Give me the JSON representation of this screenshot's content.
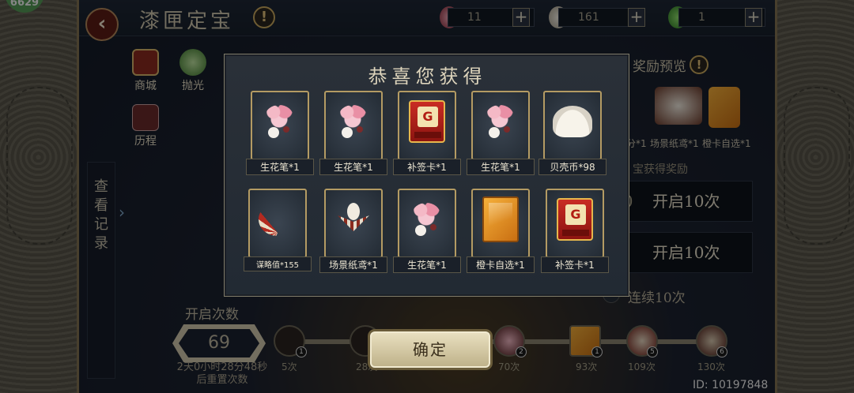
{
  "header": {
    "title": "漆匣定宝",
    "resources": [
      {
        "name": "生花笔",
        "value": "11",
        "icon": "flower-brush-icon"
      },
      {
        "name": "贝壳币",
        "value": "161",
        "icon": "shell-icon"
      },
      {
        "name": "gem",
        "value": "1",
        "icon": "green-gem-icon"
      }
    ]
  },
  "corner_badge": "6629",
  "shortcuts": {
    "shop": "商城",
    "polish": "抛光",
    "history": "历程"
  },
  "history_panel": {
    "label": "查看记录"
  },
  "preview": {
    "title": "奖励预览",
    "items": [
      "分*1",
      "场景纸鸢*1",
      "橙卡自选*1"
    ],
    "sub_title": "宝获得奖励",
    "open_buttons": [
      {
        "prefix": "00",
        "label": "开启10次"
      },
      {
        "prefix": "0",
        "label": "开启10次"
      }
    ],
    "continuous": "连续10次"
  },
  "open_count": {
    "title": "开启次数",
    "value": "69",
    "reset": "2天0小时28分48秒后重置次数"
  },
  "milestones": [
    {
      "label": "5次",
      "count": "1"
    },
    {
      "label": "28次",
      "count": ""
    },
    {
      "label": "70次",
      "count": "2"
    },
    {
      "label": "93次",
      "count": "1"
    },
    {
      "label": "109次",
      "count": "5"
    },
    {
      "label": "130次",
      "count": "6"
    }
  ],
  "user_id": "ID: 10197848",
  "modal": {
    "title": "恭喜您获得",
    "items": [
      {
        "label": "生花笔*1",
        "icon": "flower-brush-icon"
      },
      {
        "label": "生花笔*1",
        "icon": "flower-brush-icon"
      },
      {
        "label": "补签卡*1",
        "icon": "resign-card-icon"
      },
      {
        "label": "生花笔*1",
        "icon": "flower-brush-icon"
      },
      {
        "label": "贝壳币*98",
        "icon": "shell-icon"
      },
      {
        "label": "谋略值*155",
        "icon": "fan-icon"
      },
      {
        "label": "场景纸鸢*1",
        "icon": "kite-icon"
      },
      {
        "label": "生花笔*1",
        "icon": "flower-brush-icon"
      },
      {
        "label": "橙卡自选*1",
        "icon": "orange-card-icon"
      },
      {
        "label": "补签卡*1",
        "icon": "resign-card-icon"
      }
    ],
    "card_text": "补签卡",
    "confirm": "确定"
  }
}
